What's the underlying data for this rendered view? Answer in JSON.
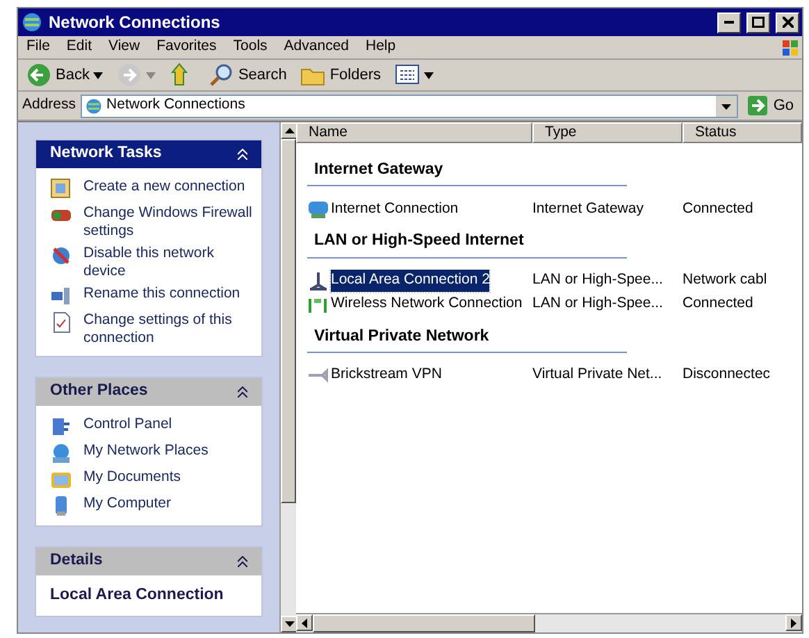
{
  "window": {
    "title": "Network Connections"
  },
  "menu": [
    {
      "label": "File"
    },
    {
      "label": "Edit"
    },
    {
      "label": "View"
    },
    {
      "label": "Favorites"
    },
    {
      "label": "Tools"
    },
    {
      "label": "Advanced"
    },
    {
      "label": "Help"
    }
  ],
  "toolbar": [
    {
      "kind": "back",
      "label": "Back"
    },
    {
      "kind": "forward"
    },
    {
      "kind": "up"
    },
    {
      "kind": "search",
      "label": "Search"
    },
    {
      "kind": "folders",
      "label": "Folders"
    },
    {
      "kind": "views"
    }
  ],
  "address": {
    "label": "Address",
    "value": "Network Connections",
    "go": "Go"
  },
  "sidebar": [
    {
      "kind": "special",
      "title": "Network Tasks",
      "expanded": true,
      "items": [
        {
          "kind": "new",
          "label": "Create a new connection"
        },
        {
          "kind": "firewall",
          "label": "Change Windows Firewall settings"
        },
        {
          "kind": "disable",
          "label": "Disable this network device"
        },
        {
          "kind": "rename",
          "label": "Rename this connection"
        },
        {
          "kind": "settings",
          "label": "Change settings of this connection"
        }
      ]
    },
    {
      "kind": "normal",
      "title": "Other Places",
      "expanded": true,
      "items": [
        {
          "kind": "panel",
          "label": "Control Panel"
        },
        {
          "kind": "network",
          "label": "My Network Places"
        },
        {
          "kind": "documents",
          "label": "My Documents"
        },
        {
          "kind": "computer",
          "label": "My Computer"
        }
      ]
    },
    {
      "kind": "normal",
      "title": "Details",
      "expanded": true,
      "text": "Local Area Connection"
    }
  ],
  "list": {
    "columns": [
      "Name",
      "Type",
      "Status"
    ],
    "groups": [
      {
        "title": "Internet Gateway",
        "rows": [
          {
            "kind": "gateway",
            "name": "Internet Connection",
            "type": "Internet Gateway",
            "status": "Connected",
            "selected": false
          }
        ]
      },
      {
        "title": "LAN or High-Speed Internet",
        "rows": [
          {
            "kind": "lan",
            "name": "Local Area Connection 2",
            "type": "LAN or High-Spee...",
            "status": "Network cabl",
            "selected": true
          },
          {
            "kind": "wireless",
            "name": "Wireless Network Connection",
            "type": "LAN or High-Spee...",
            "status": "Connected",
            "selected": false
          }
        ]
      },
      {
        "title": "Virtual Private Network",
        "rows": [
          {
            "kind": "vpn",
            "name": "Brickstream VPN",
            "type": "Virtual Private Net...",
            "status": "Disconnectec",
            "selected": false
          }
        ]
      }
    ]
  }
}
